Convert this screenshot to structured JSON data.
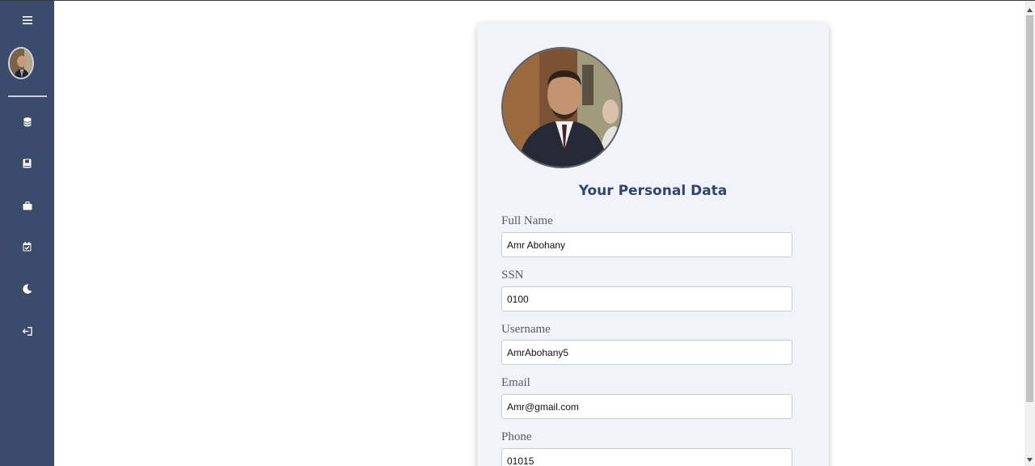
{
  "sidebar": {
    "items": [
      {
        "icon": "menu-icon"
      },
      {
        "icon": "user-avatar"
      },
      {
        "icon": "database-icon"
      },
      {
        "icon": "book-icon"
      },
      {
        "icon": "briefcase-icon"
      },
      {
        "icon": "calendar-check-icon"
      },
      {
        "icon": "moon-icon"
      },
      {
        "icon": "logout-icon"
      }
    ]
  },
  "profile": {
    "title": "Your Personal Data",
    "fields": [
      {
        "label": "Full Name",
        "value": "Amr Abohany"
      },
      {
        "label": "SSN",
        "value": "0100"
      },
      {
        "label": "Username",
        "value": "AmrAbohany5"
      },
      {
        "label": "Email",
        "value": "Amr@gmail.com"
      },
      {
        "label": "Phone",
        "value": "01015"
      }
    ]
  },
  "colors": {
    "sidebar_bg": "#3b4b6b",
    "card_bg": "#f1f3f9",
    "title_color": "#2f4470"
  }
}
